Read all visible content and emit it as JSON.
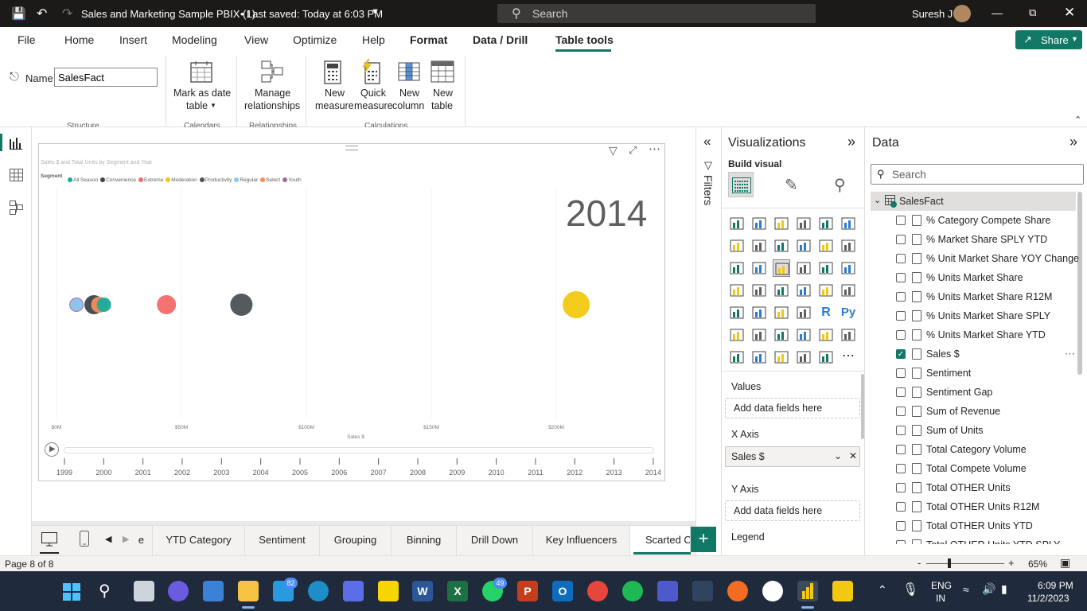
{
  "titlebar": {
    "doc_title": "Sales and Marketing Sample PBIX (1)",
    "saved": "Last saved: Today at 6:03 PM",
    "search_placeholder": "Search",
    "user": "Suresh J"
  },
  "menu": {
    "items": [
      "File",
      "Home",
      "Insert",
      "Modeling",
      "View",
      "Optimize",
      "Help",
      "Format",
      "Data / Drill",
      "Table tools"
    ],
    "share": "Share"
  },
  "ribbon": {
    "name_label": "Name",
    "name_value": "SalesFact",
    "mark_date_1": "Mark as date",
    "mark_date_2": "table",
    "manage_1": "Manage",
    "manage_2": "relationships",
    "new_measure_1": "New",
    "new_measure_2": "measure",
    "quick_measure_1": "Quick",
    "quick_measure_2": "measure",
    "new_column_1": "New",
    "new_column_2": "column",
    "new_table_1": "New",
    "new_table_2": "table",
    "groups": {
      "structure": "Structure",
      "calendars": "Calendars",
      "relationships": "Relationships",
      "calculations": "Calculations"
    }
  },
  "visual": {
    "title": "Sales $ and Total Units by Segment and Year",
    "legend_title": "Segment",
    "play_year": "2014"
  },
  "chart_data": {
    "type": "scatter",
    "title": "Sales $ and Total Units by Segment and Year",
    "xlabel": "Sales $",
    "ylabel": "",
    "x_ticks": [
      "$0M",
      "$50M",
      "$100M",
      "$150M",
      "$200M"
    ],
    "xlim": [
      0,
      240
    ],
    "legend_placement": "top-left",
    "series": [
      {
        "name": "All Season",
        "color": "#1aab9c",
        "x": 19,
        "y": 1
      },
      {
        "name": "Convenience",
        "color": "#3c4446",
        "x": 15,
        "y": 1
      },
      {
        "name": "Extreme",
        "color": "#f46a6a",
        "x": 44,
        "y": 1
      },
      {
        "name": "Moderation",
        "color": "#f2c811",
        "x": 208,
        "y": 1
      },
      {
        "name": "Productivity",
        "color": "#4c5254",
        "x": 74,
        "y": 1
      },
      {
        "name": "Regular",
        "color": "#8ec7f0",
        "x": 8,
        "y": 1
      },
      {
        "name": "Select",
        "color": "#f48c5a",
        "x": 17,
        "y": 1
      },
      {
        "name": "Youth",
        "color": "#a66999",
        "x": 8,
        "y": 1
      }
    ],
    "play_axis_years": [
      "1999",
      "2000",
      "2001",
      "2002",
      "2003",
      "2004",
      "2005",
      "2006",
      "2007",
      "2008",
      "2009",
      "2010",
      "2011",
      "2012",
      "2013",
      "2014"
    ],
    "current_year": "2014"
  },
  "filters": {
    "label": "Filters"
  },
  "visualizations": {
    "title": "Visualizations",
    "build_visual": "Build visual",
    "wells": {
      "values": "Values",
      "values_placeholder": "Add data fields here",
      "xaxis": "X Axis",
      "xaxis_value": "Sales $",
      "yaxis": "Y Axis",
      "yaxis_placeholder": "Add data fields here",
      "legend": "Legend"
    }
  },
  "data": {
    "title": "Data",
    "search_placeholder": "Search",
    "table": "SalesFact",
    "fields": [
      {
        "name": "% Category Compete Share",
        "checked": false
      },
      {
        "name": "% Market Share SPLY YTD",
        "checked": false
      },
      {
        "name": "% Unit Market Share YOY Change",
        "checked": false
      },
      {
        "name": "% Units Market Share",
        "checked": false
      },
      {
        "name": "% Units Market Share R12M",
        "checked": false
      },
      {
        "name": "% Units Market Share SPLY",
        "checked": false
      },
      {
        "name": "% Units Market Share YTD",
        "checked": false
      },
      {
        "name": "Sales $",
        "checked": true
      },
      {
        "name": "Sentiment",
        "checked": false
      },
      {
        "name": "Sentiment Gap",
        "checked": false
      },
      {
        "name": "Sum of Revenue",
        "checked": false
      },
      {
        "name": "Sum of Units",
        "checked": false
      },
      {
        "name": "Total Category Volume",
        "checked": false
      },
      {
        "name": "Total Compete Volume",
        "checked": false
      },
      {
        "name": "Total OTHER Units",
        "checked": false
      },
      {
        "name": "Total OTHER Units R12M",
        "checked": false
      },
      {
        "name": "Total OTHER Units YTD",
        "checked": false
      },
      {
        "name": "Total OTHER Units YTD SPLY",
        "checked": false
      }
    ]
  },
  "tabs": {
    "items": [
      "e",
      "YTD Category",
      "Sentiment",
      "Grouping",
      "Binning",
      "Drill Down",
      "Key Influencers",
      "Scarted Ch"
    ],
    "active": "Scarted Ch"
  },
  "status": {
    "page": "Page 8 of 8",
    "zoom": "65%",
    "zoom_minus": "-",
    "zoom_plus": "+"
  },
  "taskbar": {
    "mail_badge": "82",
    "whatsapp_badge": "49",
    "lang_1": "ENG",
    "lang_2": "IN",
    "time": "6:09 PM",
    "date": "11/2/2023"
  }
}
